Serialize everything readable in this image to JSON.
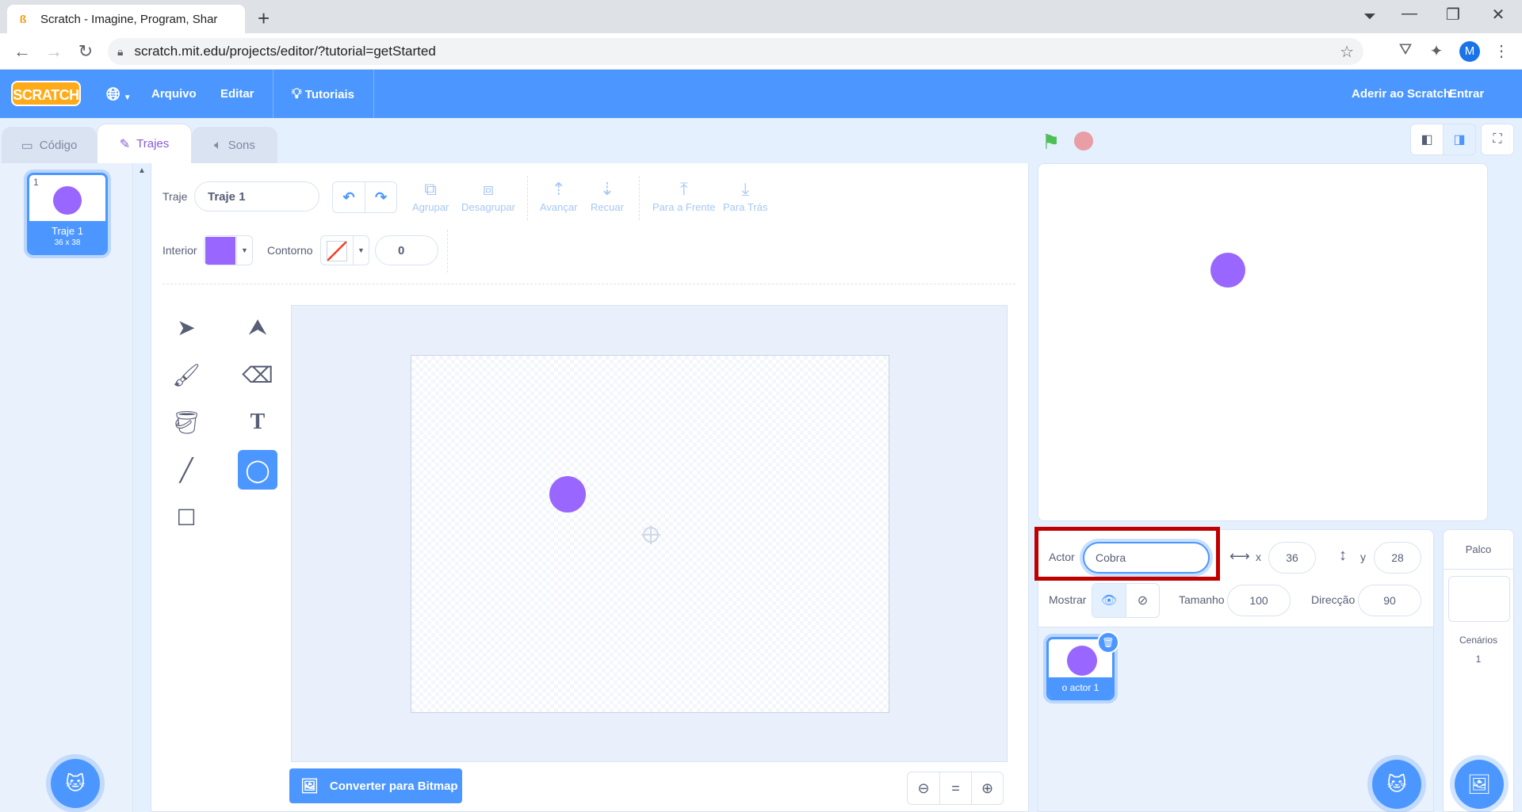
{
  "browser": {
    "tab_title": "Scratch - Imagine, Program, Shar",
    "tab_favicon": "scratch-cat-icon",
    "url": "scratch.mit.edu/projects/editor/?tutorial=getStarted",
    "profile_initial": "M"
  },
  "menubar": {
    "logo": "SCRATCH",
    "file": "Arquivo",
    "edit": "Editar",
    "tutorials": "Tutoriais",
    "join": "Aderir ao Scratch",
    "signin": "Entrar",
    "color": "#4c97ff"
  },
  "editor_tabs": [
    {
      "label": "Código",
      "icon": "code-icon",
      "active": false
    },
    {
      "label": "Trajes",
      "icon": "brush-icon",
      "active": true
    },
    {
      "label": "Sons",
      "icon": "speaker-icon",
      "active": false
    }
  ],
  "costumes": [
    {
      "number": "1",
      "name": "Traje 1",
      "size": "36 x 38",
      "color": "#9966ff"
    }
  ],
  "paint": {
    "costume_label": "Traje",
    "costume_name": "Traje 1",
    "group": "Agrupar",
    "ungroup": "Desagrupar",
    "forward": "Avançar",
    "backward": "Recuar",
    "front": "Para a Frente",
    "back": "Para Trás",
    "fill_label": "Interior",
    "fill_color": "#9966ff",
    "outline_label": "Contorno",
    "outline_width": "0",
    "convert_button": "Converter para Bitmap",
    "tools": [
      "select-icon",
      "reshape-icon",
      "brush-icon",
      "eraser-icon",
      "fill-icon",
      "text-icon",
      "line-icon",
      "circle-icon",
      "rectangle-icon"
    ],
    "active_tool": "circle-icon"
  },
  "sprite_info": {
    "sprite_label": "Actor",
    "sprite_name": "Cobra",
    "x_label": "x",
    "x": "36",
    "y_label": "y",
    "y": "28",
    "show_label": "Mostrar",
    "size_label": "Tamanho",
    "size": "100",
    "direction_label": "Direcção",
    "direction": "90"
  },
  "sprites": [
    {
      "name": "o actor 1",
      "color": "#9966ff"
    }
  ],
  "stage_panel": {
    "title": "Palco",
    "backdrops_label": "Cenários",
    "backdrops_count": "1"
  },
  "highlight_color": "#c00000"
}
